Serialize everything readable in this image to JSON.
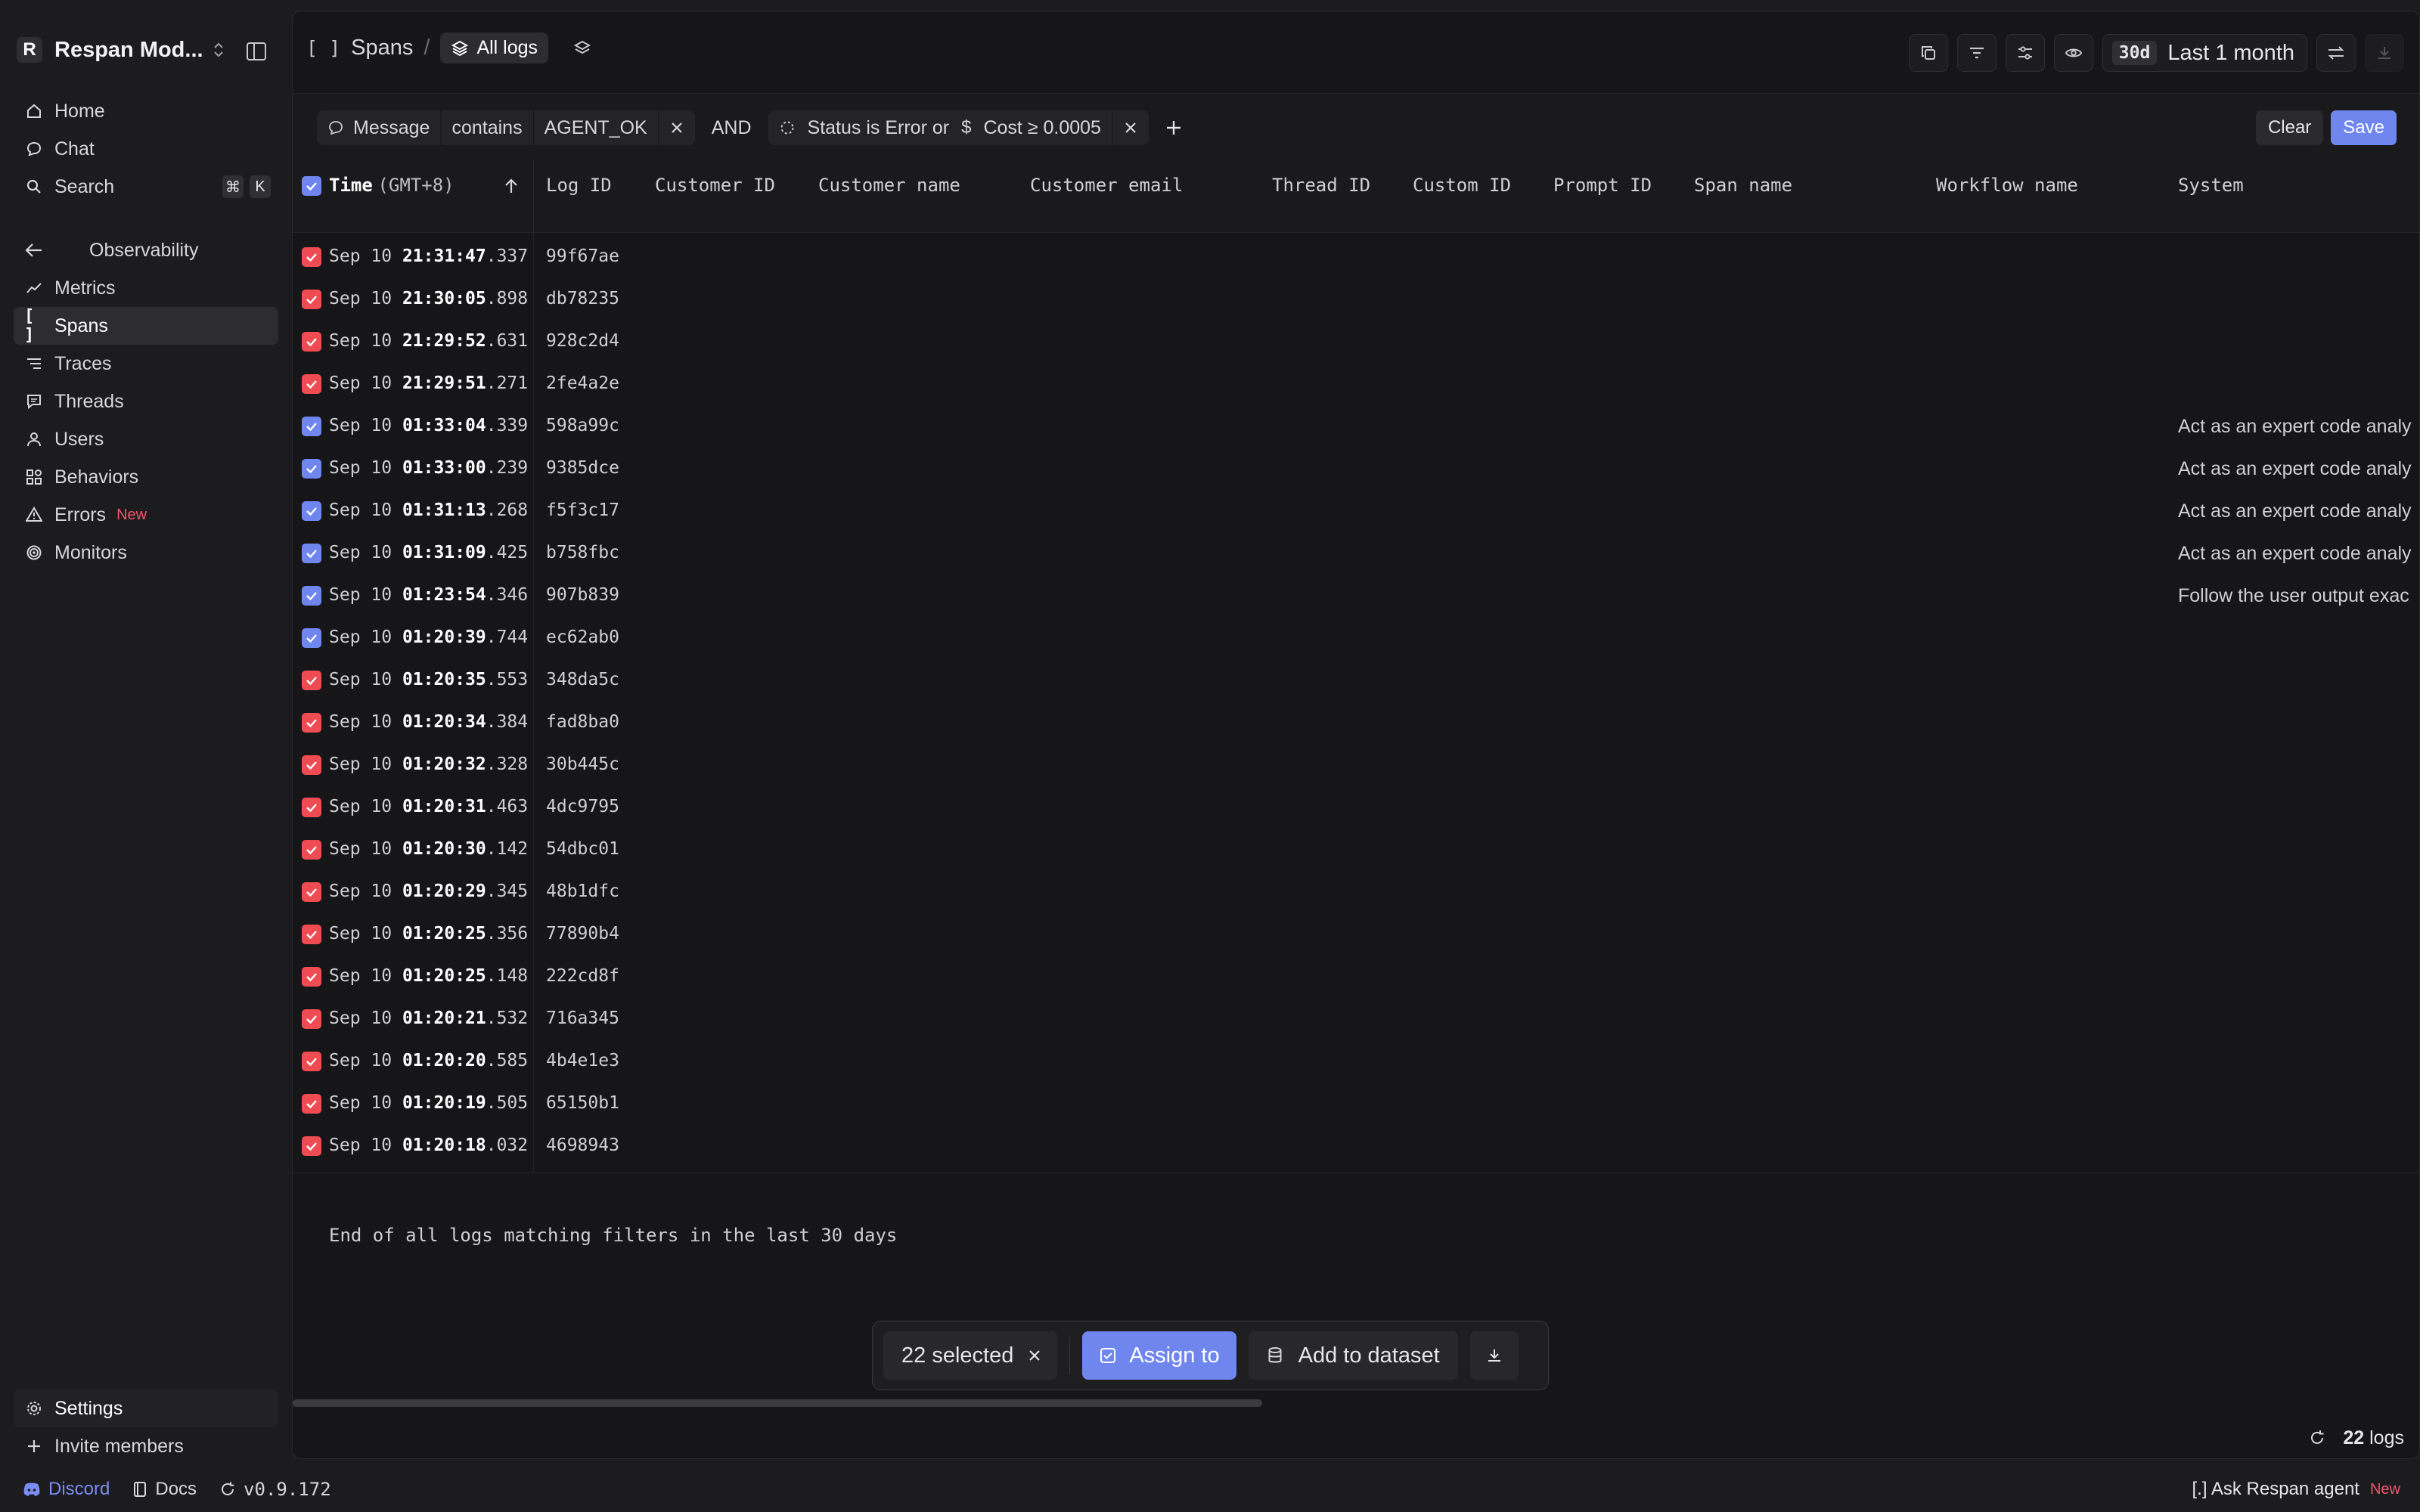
{
  "workspace": {
    "initial": "R",
    "name": "Respan Mod..."
  },
  "nav_top": [
    {
      "label": "Home",
      "icon": "home-icon"
    },
    {
      "label": "Chat",
      "icon": "chat-icon"
    },
    {
      "label": "Search",
      "icon": "search-icon",
      "shortcut": [
        "⌘",
        "K"
      ]
    }
  ],
  "observability": {
    "heading": "Observability",
    "items": [
      {
        "label": "Metrics",
        "icon": "metrics-icon"
      },
      {
        "label": "Spans",
        "icon": "spans-icon",
        "active": true
      },
      {
        "label": "Traces",
        "icon": "traces-icon"
      },
      {
        "label": "Threads",
        "icon": "threads-icon"
      },
      {
        "label": "Users",
        "icon": "user-icon"
      },
      {
        "label": "Behaviors",
        "icon": "behaviors-icon"
      },
      {
        "label": "Errors",
        "icon": "warning-icon",
        "badge": "New"
      },
      {
        "label": "Monitors",
        "icon": "monitor-icon"
      }
    ]
  },
  "sidebar_bottom": {
    "settings": "Settings",
    "invite": "Invite members"
  },
  "bottombar": {
    "discord": "Discord",
    "docs": "Docs",
    "version": "v0.9.172",
    "agent": "[.] Ask Respan agent",
    "agent_badge": "New"
  },
  "header": {
    "spans_glyph": "[ ]",
    "spans_label": "Spans",
    "separator": "/",
    "view_label": "All logs",
    "range_pill": "30d",
    "range_label": "Last 1 month"
  },
  "filters": {
    "message_field": "Message",
    "message_op": "contains",
    "message_value": "AGENT_OK",
    "and": "AND",
    "status_text": "Status is Error or",
    "cost_text": "Cost ≥ 0.0005",
    "clear": "Clear",
    "save": "Save"
  },
  "table": {
    "time_header": "Time",
    "time_zone": "(GMT+8)",
    "columns": [
      "Log ID",
      "Customer ID",
      "Customer name",
      "Customer email",
      "Thread ID",
      "Custom ID",
      "Prompt ID",
      "Span name",
      "Workflow name",
      "System"
    ],
    "rows": [
      {
        "date": "Sep 10",
        "hms": "21:31:47",
        "ms": ".337",
        "id": "99f67ae",
        "status": "error",
        "system": ""
      },
      {
        "date": "Sep 10",
        "hms": "21:30:05",
        "ms": ".898",
        "id": "db78235",
        "status": "error",
        "system": ""
      },
      {
        "date": "Sep 10",
        "hms": "21:29:52",
        "ms": ".631",
        "id": "928c2d4",
        "status": "error",
        "system": ""
      },
      {
        "date": "Sep 10",
        "hms": "21:29:51",
        "ms": ".271",
        "id": "2fe4a2e",
        "status": "error",
        "system": ""
      },
      {
        "date": "Sep 10",
        "hms": "01:33:04",
        "ms": ".339",
        "id": "598a99c",
        "status": "ok",
        "system": "Act as an expert code analy"
      },
      {
        "date": "Sep 10",
        "hms": "01:33:00",
        "ms": ".239",
        "id": "9385dce",
        "status": "ok",
        "system": "Act as an expert code analy"
      },
      {
        "date": "Sep 10",
        "hms": "01:31:13",
        "ms": ".268",
        "id": "f5f3c17",
        "status": "ok",
        "system": "Act as an expert code analy"
      },
      {
        "date": "Sep 10",
        "hms": "01:31:09",
        "ms": ".425",
        "id": "b758fbc",
        "status": "ok",
        "system": "Act as an expert code analy"
      },
      {
        "date": "Sep 10",
        "hms": "01:23:54",
        "ms": ".346",
        "id": "907b839",
        "status": "ok",
        "system": "Follow the user output exac"
      },
      {
        "date": "Sep 10",
        "hms": "01:20:39",
        "ms": ".744",
        "id": "ec62ab0",
        "status": "ok",
        "system": ""
      },
      {
        "date": "Sep 10",
        "hms": "01:20:35",
        "ms": ".553",
        "id": "348da5c",
        "status": "error",
        "system": ""
      },
      {
        "date": "Sep 10",
        "hms": "01:20:34",
        "ms": ".384",
        "id": "fad8ba0",
        "status": "error",
        "system": ""
      },
      {
        "date": "Sep 10",
        "hms": "01:20:32",
        "ms": ".328",
        "id": "30b445c",
        "status": "error",
        "system": ""
      },
      {
        "date": "Sep 10",
        "hms": "01:20:31",
        "ms": ".463",
        "id": "4dc9795",
        "status": "error",
        "system": ""
      },
      {
        "date": "Sep 10",
        "hms": "01:20:30",
        "ms": ".142",
        "id": "54dbc01",
        "status": "error",
        "system": ""
      },
      {
        "date": "Sep 10",
        "hms": "01:20:29",
        "ms": ".345",
        "id": "48b1dfc",
        "status": "error",
        "system": ""
      },
      {
        "date": "Sep 10",
        "hms": "01:20:25",
        "ms": ".356",
        "id": "77890b4",
        "status": "error",
        "system": ""
      },
      {
        "date": "Sep 10",
        "hms": "01:20:25",
        "ms": ".148",
        "id": "222cd8f",
        "status": "error",
        "system": ""
      },
      {
        "date": "Sep 10",
        "hms": "01:20:21",
        "ms": ".532",
        "id": "716a345",
        "status": "error",
        "system": ""
      },
      {
        "date": "Sep 10",
        "hms": "01:20:20",
        "ms": ".585",
        "id": "4b4e1e3",
        "status": "error",
        "system": ""
      },
      {
        "date": "Sep 10",
        "hms": "01:20:19",
        "ms": ".505",
        "id": "65150b1",
        "status": "error",
        "system": ""
      },
      {
        "date": "Sep 10",
        "hms": "01:20:18",
        "ms": ".032",
        "id": "4698943",
        "status": "error",
        "system": ""
      }
    ],
    "end_message": "End of all logs matching filters in the last 30 days"
  },
  "selection": {
    "selected": "22 selected",
    "assign": "Assign to",
    "add_dataset": "Add to dataset"
  },
  "footer": {
    "count": "22",
    "count_suffix": "logs"
  },
  "colors": {
    "accent": "#6f86ef",
    "error": "#ef4b52",
    "new_badge": "#f0566b"
  }
}
